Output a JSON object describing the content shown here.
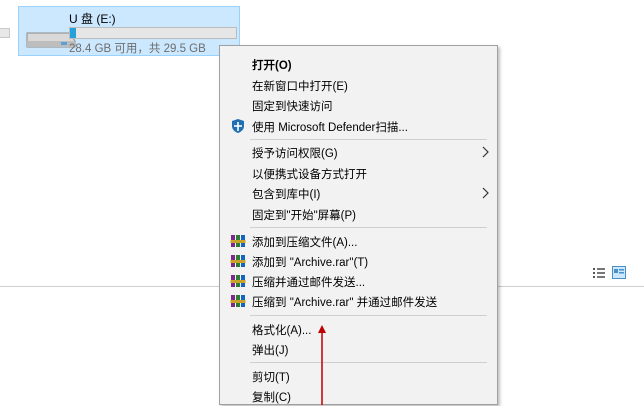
{
  "drive": {
    "name": "U 盘 (E:)",
    "free_text": "28.4 GB 可用，共 29.5 GB",
    "used_fraction": 0.037
  },
  "colors": {
    "selection_bg": "#cce8ff",
    "progress_fill": "#26a0da",
    "menu_bg": "#f2f2f2",
    "annotation_arrow": "#c00000"
  },
  "context_menu": {
    "open": "打开(O)",
    "open_new_window": "在新窗口中打开(E)",
    "pin_quick_access": "固定到快速访问",
    "defender_scan": "使用 Microsoft Defender扫描...",
    "grant_access": "授予访问权限(G)",
    "open_portable": "以便携式设备方式打开",
    "include_library": "包含到库中(I)",
    "pin_start": "固定到\"开始\"屏幕(P)",
    "add_archive": "添加到压缩文件(A)...",
    "add_archive_rar": "添加到 \"Archive.rar\"(T)",
    "compress_email": "压缩并通过邮件发送...",
    "compress_rar_email": "压缩到 \"Archive.rar\" 并通过邮件发送",
    "format": "格式化(A)...",
    "eject": "弹出(J)",
    "cut": "剪切(T)",
    "copy": "复制(C)"
  },
  "icons": {
    "drive": "usb-drive-icon",
    "defender": "defender-shield-icon",
    "winrar": "winrar-books-icon",
    "view_details": "details-view-icon",
    "view_tiles": "tiles-view-icon"
  }
}
